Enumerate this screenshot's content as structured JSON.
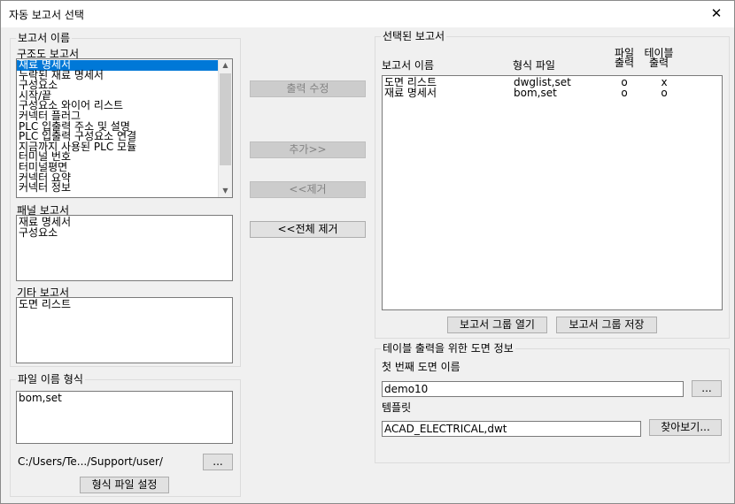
{
  "window": {
    "title": "자동 보고서 선택",
    "close_glyph": "✕"
  },
  "report_names": {
    "group_label": "보고서 이름",
    "schematic": {
      "label": "구조도 보고서",
      "items": [
        "재료 명세서",
        "누락된 재료 명세서",
        "구성요소",
        "시작/끝",
        "구성요소 와이어 리스트",
        "커넥터 플러그",
        "PLC 입출력 주소 및 설명",
        "PLC 입출력 구성요소 연결",
        "지금까지 사용된 PLC 모듈",
        "터미널 번호",
        "터미널평면",
        "커넥터 요약",
        "커넥터 정보"
      ],
      "selected": "재료 명세서"
    },
    "panel": {
      "label": "패널 보고서",
      "items": [
        "재료 명세서",
        "구성요소"
      ]
    },
    "other": {
      "label": "기타 보고서",
      "items": [
        "도면 리스트"
      ]
    }
  },
  "file_name_format": {
    "group_label": "파일 이름 형식",
    "items": [
      "bom,set"
    ],
    "path": "C:/Users/Te.../Support/user/",
    "browse_label": "...",
    "set_button": "형식 파일 설정"
  },
  "middle_buttons": {
    "edit_output": "출력 수정",
    "add": "추가>>",
    "remove": "<<제거",
    "remove_all": "<<전체 제거"
  },
  "selected_reports": {
    "group_label": "선택된 보고서",
    "headers": {
      "name": "보고서 이름",
      "format": "형식 파일",
      "file_out_1": "파일",
      "file_out_2": "출력",
      "table_out_1": "테이블",
      "table_out_2": "출력"
    },
    "rows": [
      {
        "name": "도면 리스트",
        "format": "dwglist,set",
        "file_out": "o",
        "table_out": "x"
      },
      {
        "name": "재료 명세서",
        "format": "bom,set",
        "file_out": "o",
        "table_out": "o"
      }
    ],
    "open_group": "보고서 그룹 열기",
    "save_group": "보고서 그룹 저장"
  },
  "table_output_info": {
    "group_label": "테이블 출력을 위한 도면 정보",
    "first_drawing_label": "첫 번째 도면 이름",
    "first_drawing_value": "demo10",
    "first_browse": "...",
    "template_label": "템플릿",
    "template_value": "ACAD_ELECTRICAL,dwt",
    "template_browse": "찾아보기..."
  }
}
